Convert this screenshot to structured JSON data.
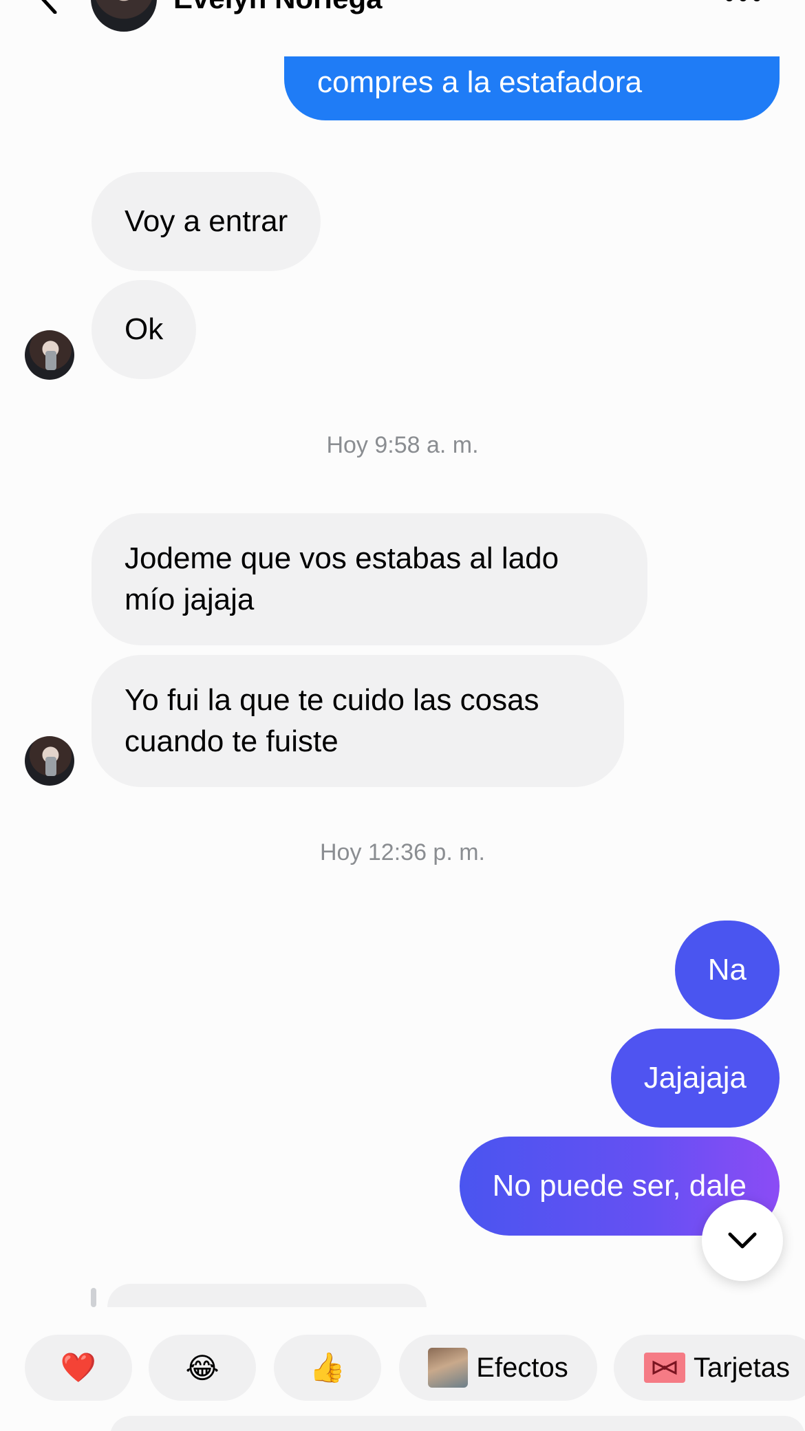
{
  "header": {
    "contact_name": "Evelyn Noriega"
  },
  "messages": {
    "out_top": "compres a la estafadora",
    "in_1": "Voy a entrar",
    "in_2": "Ok",
    "time_1": "Hoy 9:58 a. m.",
    "in_3_line1": "Jodeme que vos estabas al lado",
    "in_3_line2": "mío jajaja",
    "in_4_line1": "Yo fui la que te cuido las cosas",
    "in_4_line2": "cuando te fuiste",
    "time_2": "Hoy 12:36 p. m.",
    "out_1": "Na",
    "out_2": "Jajajaja",
    "out_3": "No puede ser, dale"
  },
  "quick_reactions": {
    "heart": "❤️",
    "laugh": "😂",
    "thumbs_up": "👍",
    "effects_label": "Efectos",
    "cards_label": "Tarjetas"
  },
  "colors": {
    "outgoing_blue": "#1f7cf6",
    "outgoing_gradient_start": "#4a55f0",
    "outgoing_gradient_end": "#8b4cf5",
    "incoming_bg": "#f1f1f2"
  }
}
